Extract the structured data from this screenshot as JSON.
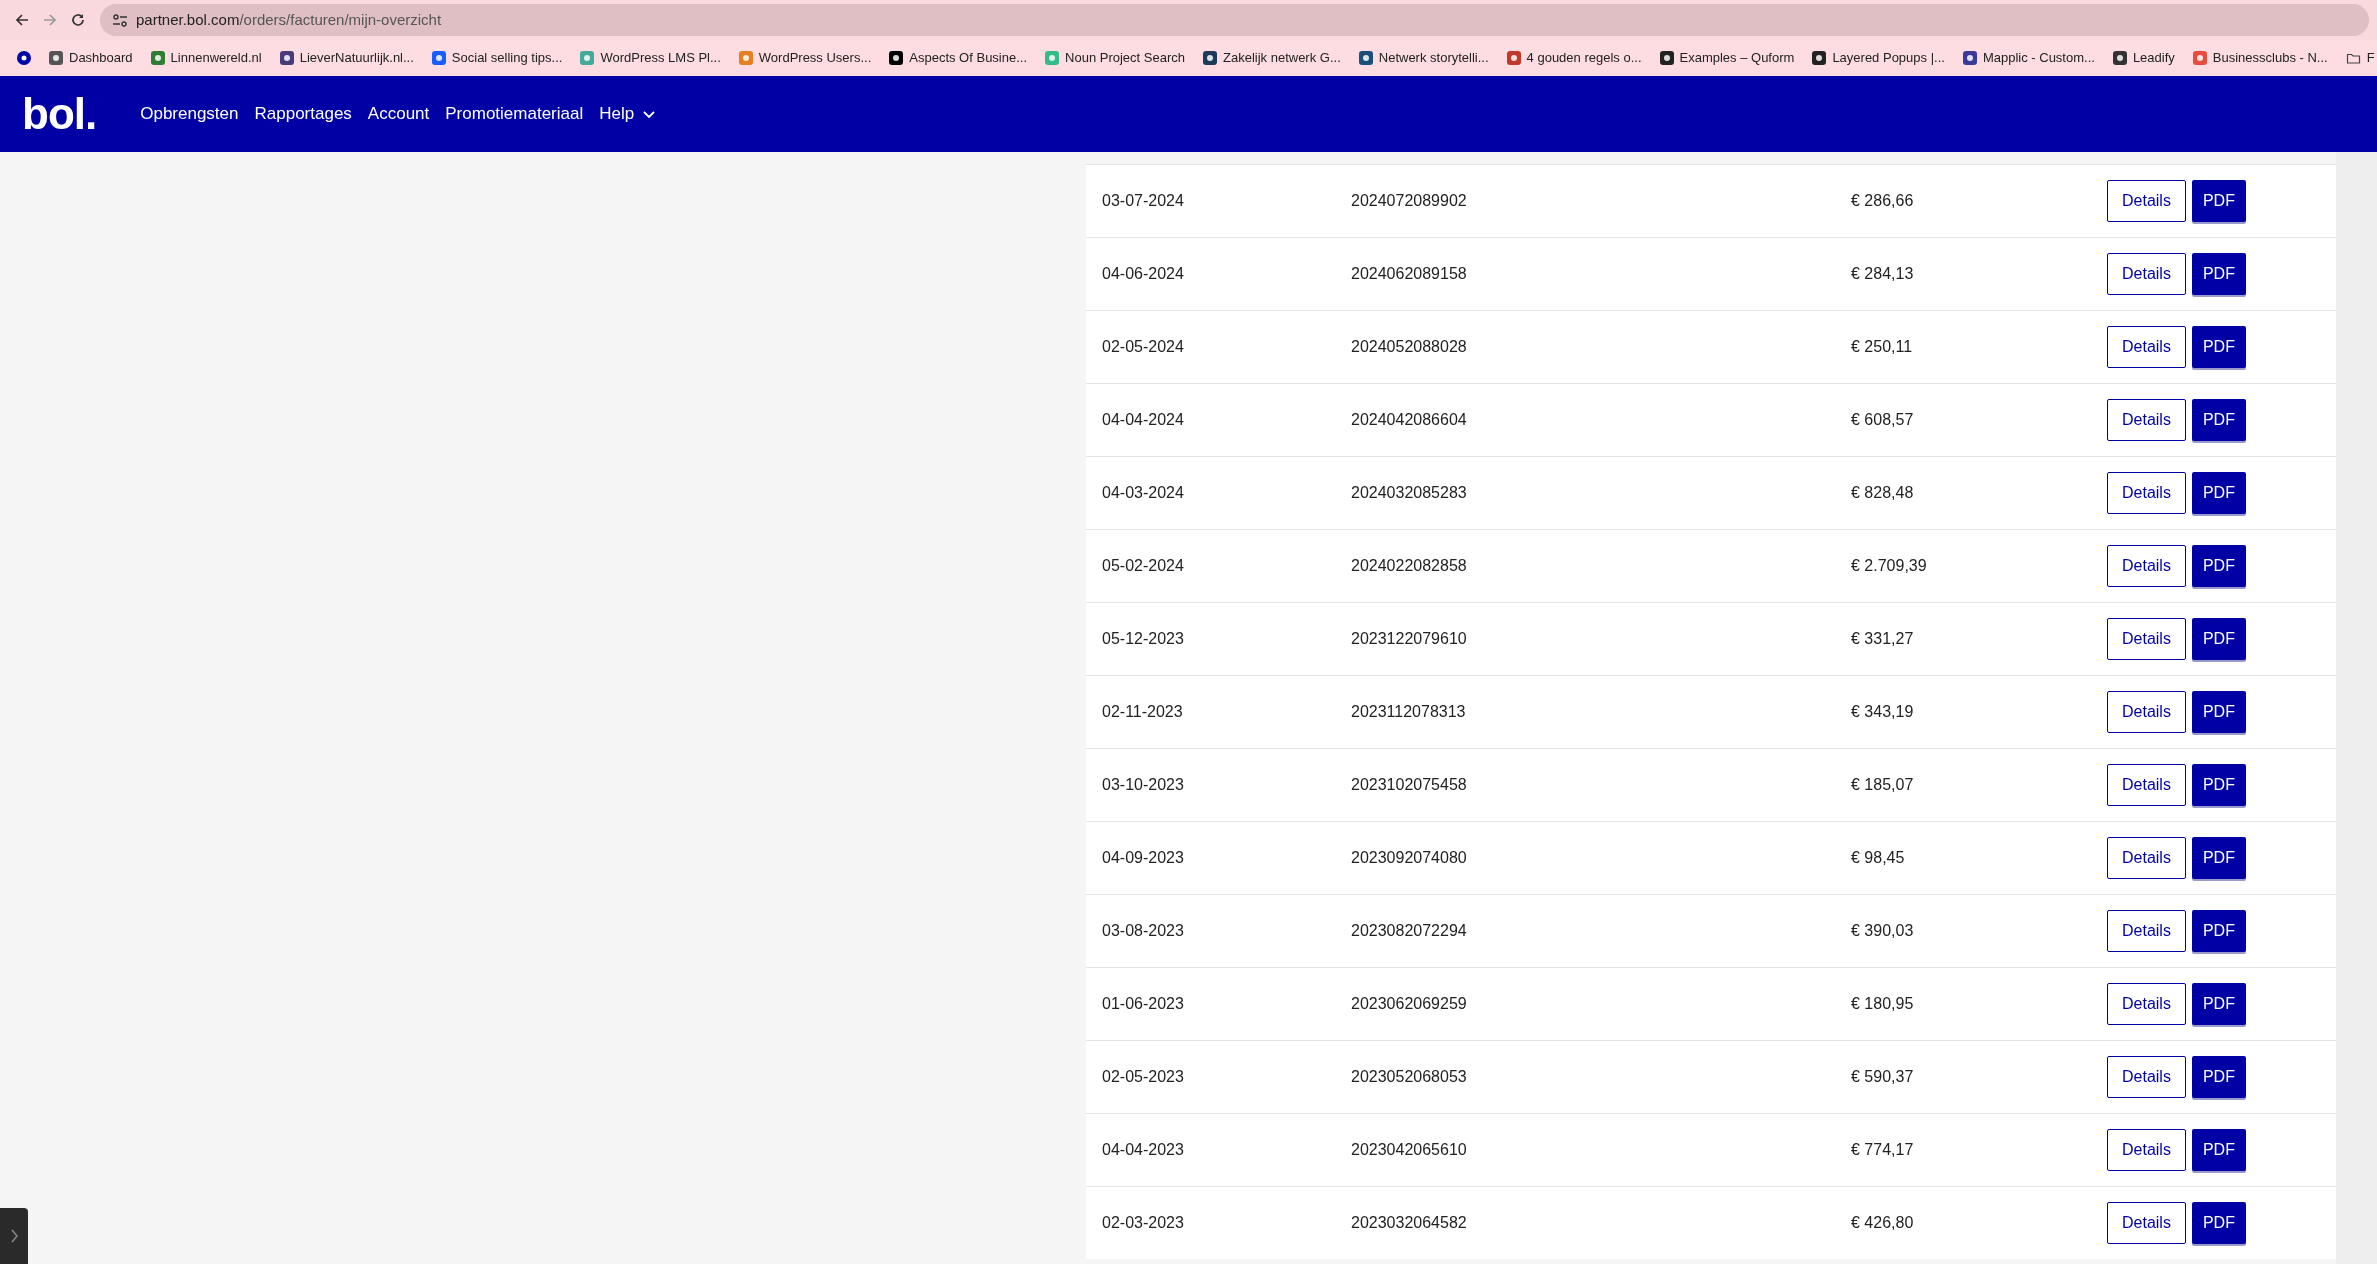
{
  "browser": {
    "url_host": "partner.bol.com",
    "url_path": "/orders/facturen/mijn-overzicht"
  },
  "bookmarks": [
    {
      "kind": "icon"
    },
    {
      "kind": "site",
      "label": "Dashboard"
    },
    {
      "kind": "site",
      "label": "Linnenwereld.nl"
    },
    {
      "kind": "site",
      "label": "LieverNatuurlijk.nl..."
    },
    {
      "kind": "site",
      "label": "Social selling tips..."
    },
    {
      "kind": "site",
      "label": "WordPress LMS Pl..."
    },
    {
      "kind": "site",
      "label": "WordPress Users..."
    },
    {
      "kind": "site",
      "label": "Aspects Of Busine..."
    },
    {
      "kind": "site",
      "label": "Noun Project Search"
    },
    {
      "kind": "site",
      "label": "Zakelijk netwerk G..."
    },
    {
      "kind": "site",
      "label": "Netwerk storytelli..."
    },
    {
      "kind": "site",
      "label": "4 gouden regels o..."
    },
    {
      "kind": "site",
      "label": "Examples – Quform"
    },
    {
      "kind": "site",
      "label": "Layered Popups |..."
    },
    {
      "kind": "site",
      "label": "Mapplic - Custom..."
    },
    {
      "kind": "site",
      "label": "Leadify"
    },
    {
      "kind": "site",
      "label": "Businessclubs - N..."
    },
    {
      "kind": "folder",
      "label": "F"
    }
  ],
  "navbar": {
    "logo": "bol.",
    "items": [
      {
        "label": "Opbrengsten",
        "kind": "link"
      },
      {
        "label": "Rapportages",
        "kind": "link"
      },
      {
        "label": "Account",
        "kind": "link"
      },
      {
        "label": "Promotiemateriaal",
        "kind": "link"
      },
      {
        "label": "Help",
        "kind": "dropdown"
      }
    ]
  },
  "invoices": [
    {
      "date": "03-07-2024",
      "number": "2024072089902",
      "amount": "€ 286,66",
      "details": "Details",
      "pdf": "PDF"
    },
    {
      "date": "04-06-2024",
      "number": "2024062089158",
      "amount": "€ 284,13",
      "details": "Details",
      "pdf": "PDF"
    },
    {
      "date": "02-05-2024",
      "number": "2024052088028",
      "amount": "€ 250,11",
      "details": "Details",
      "pdf": "PDF"
    },
    {
      "date": "04-04-2024",
      "number": "2024042086604",
      "amount": "€ 608,57",
      "details": "Details",
      "pdf": "PDF"
    },
    {
      "date": "04-03-2024",
      "number": "2024032085283",
      "amount": "€ 828,48",
      "details": "Details",
      "pdf": "PDF"
    },
    {
      "date": "05-02-2024",
      "number": "2024022082858",
      "amount": "€ 2.709,39",
      "details": "Details",
      "pdf": "PDF"
    },
    {
      "date": "05-12-2023",
      "number": "2023122079610",
      "amount": "€ 331,27",
      "details": "Details",
      "pdf": "PDF"
    },
    {
      "date": "02-11-2023",
      "number": "2023112078313",
      "amount": "€ 343,19",
      "details": "Details",
      "pdf": "PDF"
    },
    {
      "date": "03-10-2023",
      "number": "2023102075458",
      "amount": "€ 185,07",
      "details": "Details",
      "pdf": "PDF"
    },
    {
      "date": "04-09-2023",
      "number": "2023092074080",
      "amount": "€ 98,45",
      "details": "Details",
      "pdf": "PDF"
    },
    {
      "date": "03-08-2023",
      "number": "2023082072294",
      "amount": "€ 390,03",
      "details": "Details",
      "pdf": "PDF"
    },
    {
      "date": "01-06-2023",
      "number": "2023062069259",
      "amount": "€ 180,95",
      "details": "Details",
      "pdf": "PDF"
    },
    {
      "date": "02-05-2023",
      "number": "2023052068053",
      "amount": "€ 590,37",
      "details": "Details",
      "pdf": "PDF"
    },
    {
      "date": "04-04-2023",
      "number": "2023042065610",
      "amount": "€ 774,17",
      "details": "Details",
      "pdf": "PDF"
    },
    {
      "date": "02-03-2023",
      "number": "2023032064582",
      "amount": "€ 426,80",
      "details": "Details",
      "pdf": "PDF"
    }
  ]
}
